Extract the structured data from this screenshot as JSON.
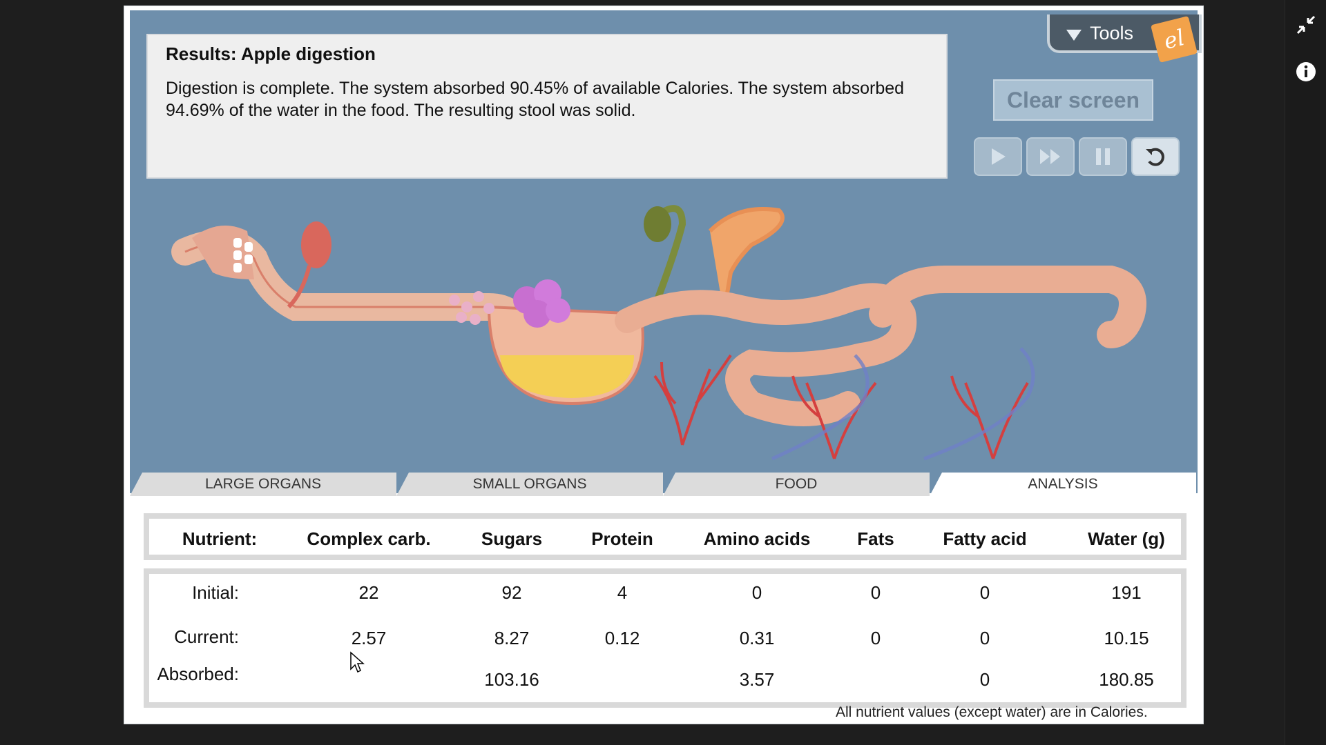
{
  "results": {
    "title": "Results: Apple digestion",
    "text": "Digestion is complete. The system absorbed 90.45% of available Calories. The system absorbed 94.69% of the water in the food. The resulting stool was solid."
  },
  "tools": {
    "label": "Tools",
    "logo_text": "el"
  },
  "controls": {
    "clear_label": "Clear screen"
  },
  "tabs": [
    "LARGE ORGANS",
    "SMALL ORGANS",
    "FOOD",
    "ANALYSIS"
  ],
  "active_tab": "ANALYSIS",
  "table": {
    "headers": [
      "Nutrient:",
      "Complex carb.",
      "Sugars",
      "Protein",
      "Amino acids",
      "Fats",
      "Fatty acid",
      "Water (g)"
    ],
    "rows": [
      {
        "label": "Initial:",
        "values": [
          "22",
          "92",
          "4",
          "0",
          "0",
          "0",
          "191"
        ]
      },
      {
        "label": "Current:",
        "values": [
          "2.57",
          "8.27",
          "0.12",
          "0.31",
          "0",
          "0",
          "10.15"
        ]
      },
      {
        "label": "Absorbed:",
        "values": [
          "",
          "103.16",
          "",
          "3.57",
          "",
          "0",
          "180.85"
        ]
      }
    ],
    "footnote": "All nutrient values (except water) are in Calories."
  },
  "icons": [
    "collapse-icon",
    "info-icon",
    "play-icon",
    "fast-forward-icon",
    "pause-icon",
    "reset-icon",
    "tools-arrow-icon"
  ]
}
